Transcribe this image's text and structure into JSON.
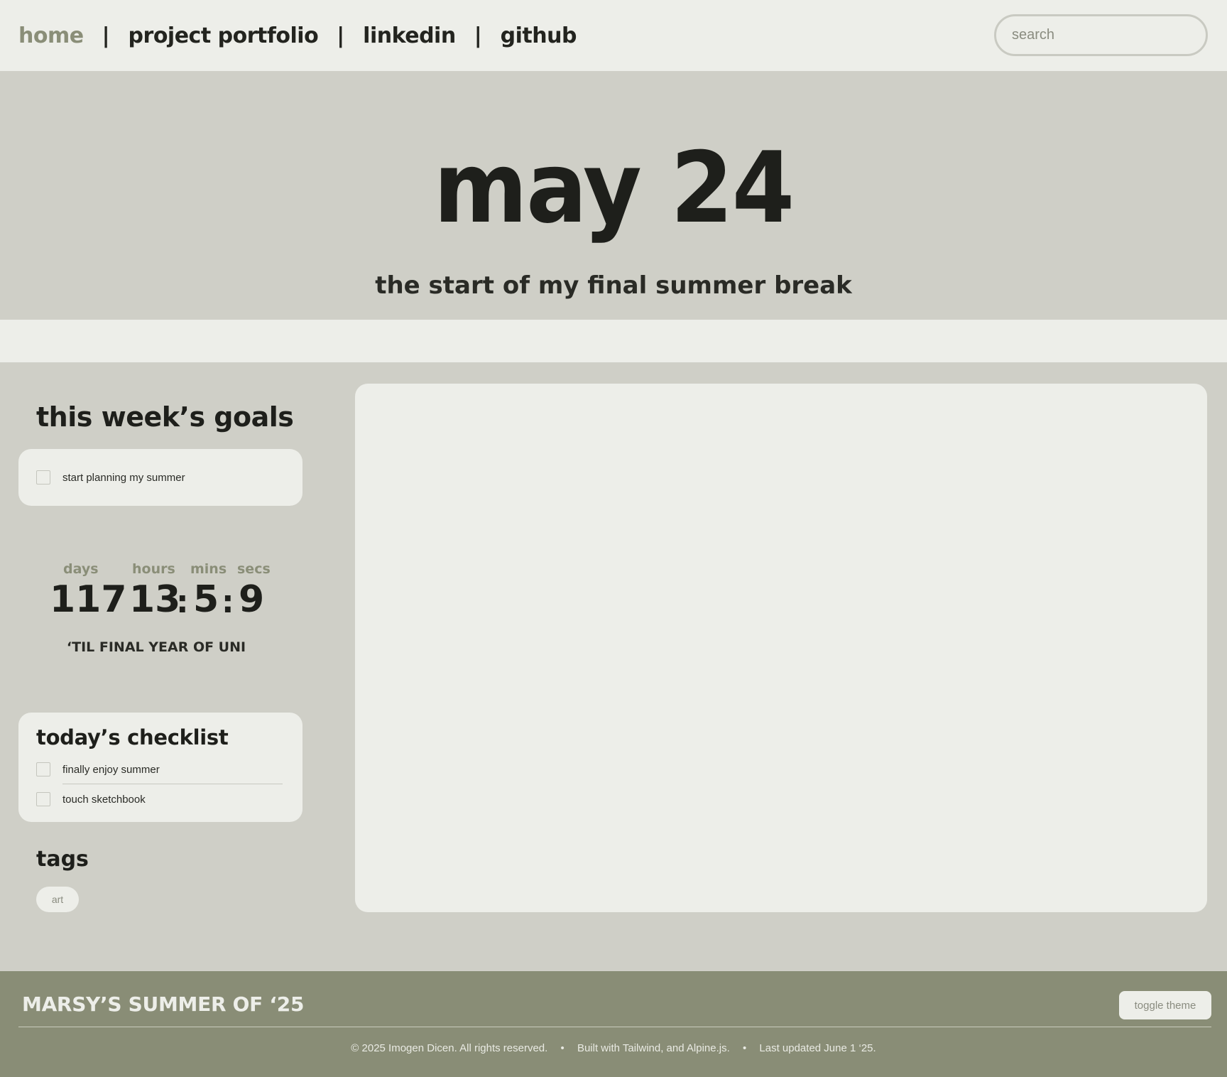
{
  "nav": {
    "links": [
      "home",
      "project portfolio",
      "linkedin",
      "github"
    ],
    "separator": "|",
    "active": "home",
    "search_placeholder": "search"
  },
  "hero": {
    "date": "may 24",
    "subtitle": "the start of my final summer break"
  },
  "goals": {
    "heading": "this week’s goals",
    "items": [
      {
        "label": "start planning my summer",
        "checked": false
      }
    ]
  },
  "countdown": {
    "labels": [
      "days",
      "hours",
      "mins",
      "secs"
    ],
    "days": "117",
    "hours": "13",
    "mins": "5",
    "secs": "9",
    "colon": ":",
    "caption": "‘TIL FINAL YEAR OF UNI"
  },
  "checklist": {
    "heading": "today’s checklist",
    "items": [
      {
        "label": "finally enjoy summer",
        "checked": false
      },
      {
        "label": "touch sketchbook",
        "checked": false
      }
    ]
  },
  "tags": {
    "heading": "tags",
    "items": [
      "art"
    ]
  },
  "footer": {
    "title": "MARSY’S SUMMER OF ‘25",
    "toggle_label": "toggle theme",
    "copyright": "© 2025 Imogen Dicen. All rights reserved.",
    "built_with": "Built with Tailwind, and Alpine.js.",
    "updated": "Last updated June 1 ‘25.",
    "bullet": "•"
  },
  "colors": {
    "accent": "#8a8e78",
    "background": "#cfcfc7",
    "panel": "#edeee9",
    "footer": "#898d76",
    "text": "#1e1f1b"
  }
}
